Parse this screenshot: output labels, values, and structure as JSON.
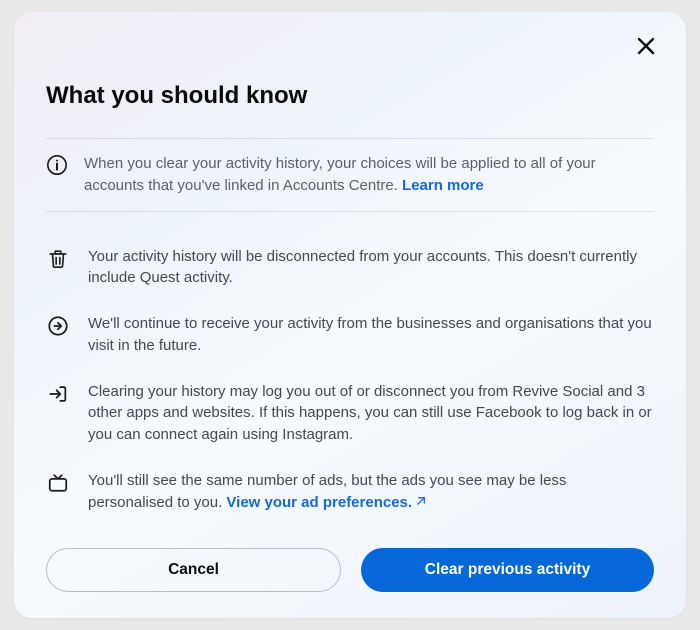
{
  "title": "What you should know",
  "info": {
    "text": "When you clear your activity history, your choices will be applied to all of your accounts that you've linked in Accounts Centre. ",
    "link": "Learn more"
  },
  "items": [
    {
      "icon": "trash-icon",
      "text": "Your activity history will be disconnected from your accounts. This doesn't currently include Quest activity."
    },
    {
      "icon": "arrow-circle-right-icon",
      "text": "We'll continue to receive your activity from the businesses and organisations that you visit in the future."
    },
    {
      "icon": "logout-icon",
      "text": "Clearing your history may log you out of or disconnect you from Revive Social and 3 other apps and websites. If this happens, you can still use Facebook to log back in or you can connect again using Instagram."
    },
    {
      "icon": "tv-icon",
      "text": "You'll still see the same number of ads, but the ads you see may be less personalised to you. ",
      "link": "View your ad preferences."
    }
  ],
  "buttons": {
    "cancel": "Cancel",
    "confirm": "Clear previous activity"
  },
  "colors": {
    "primary": "#0667d8",
    "link": "#1568d6"
  }
}
